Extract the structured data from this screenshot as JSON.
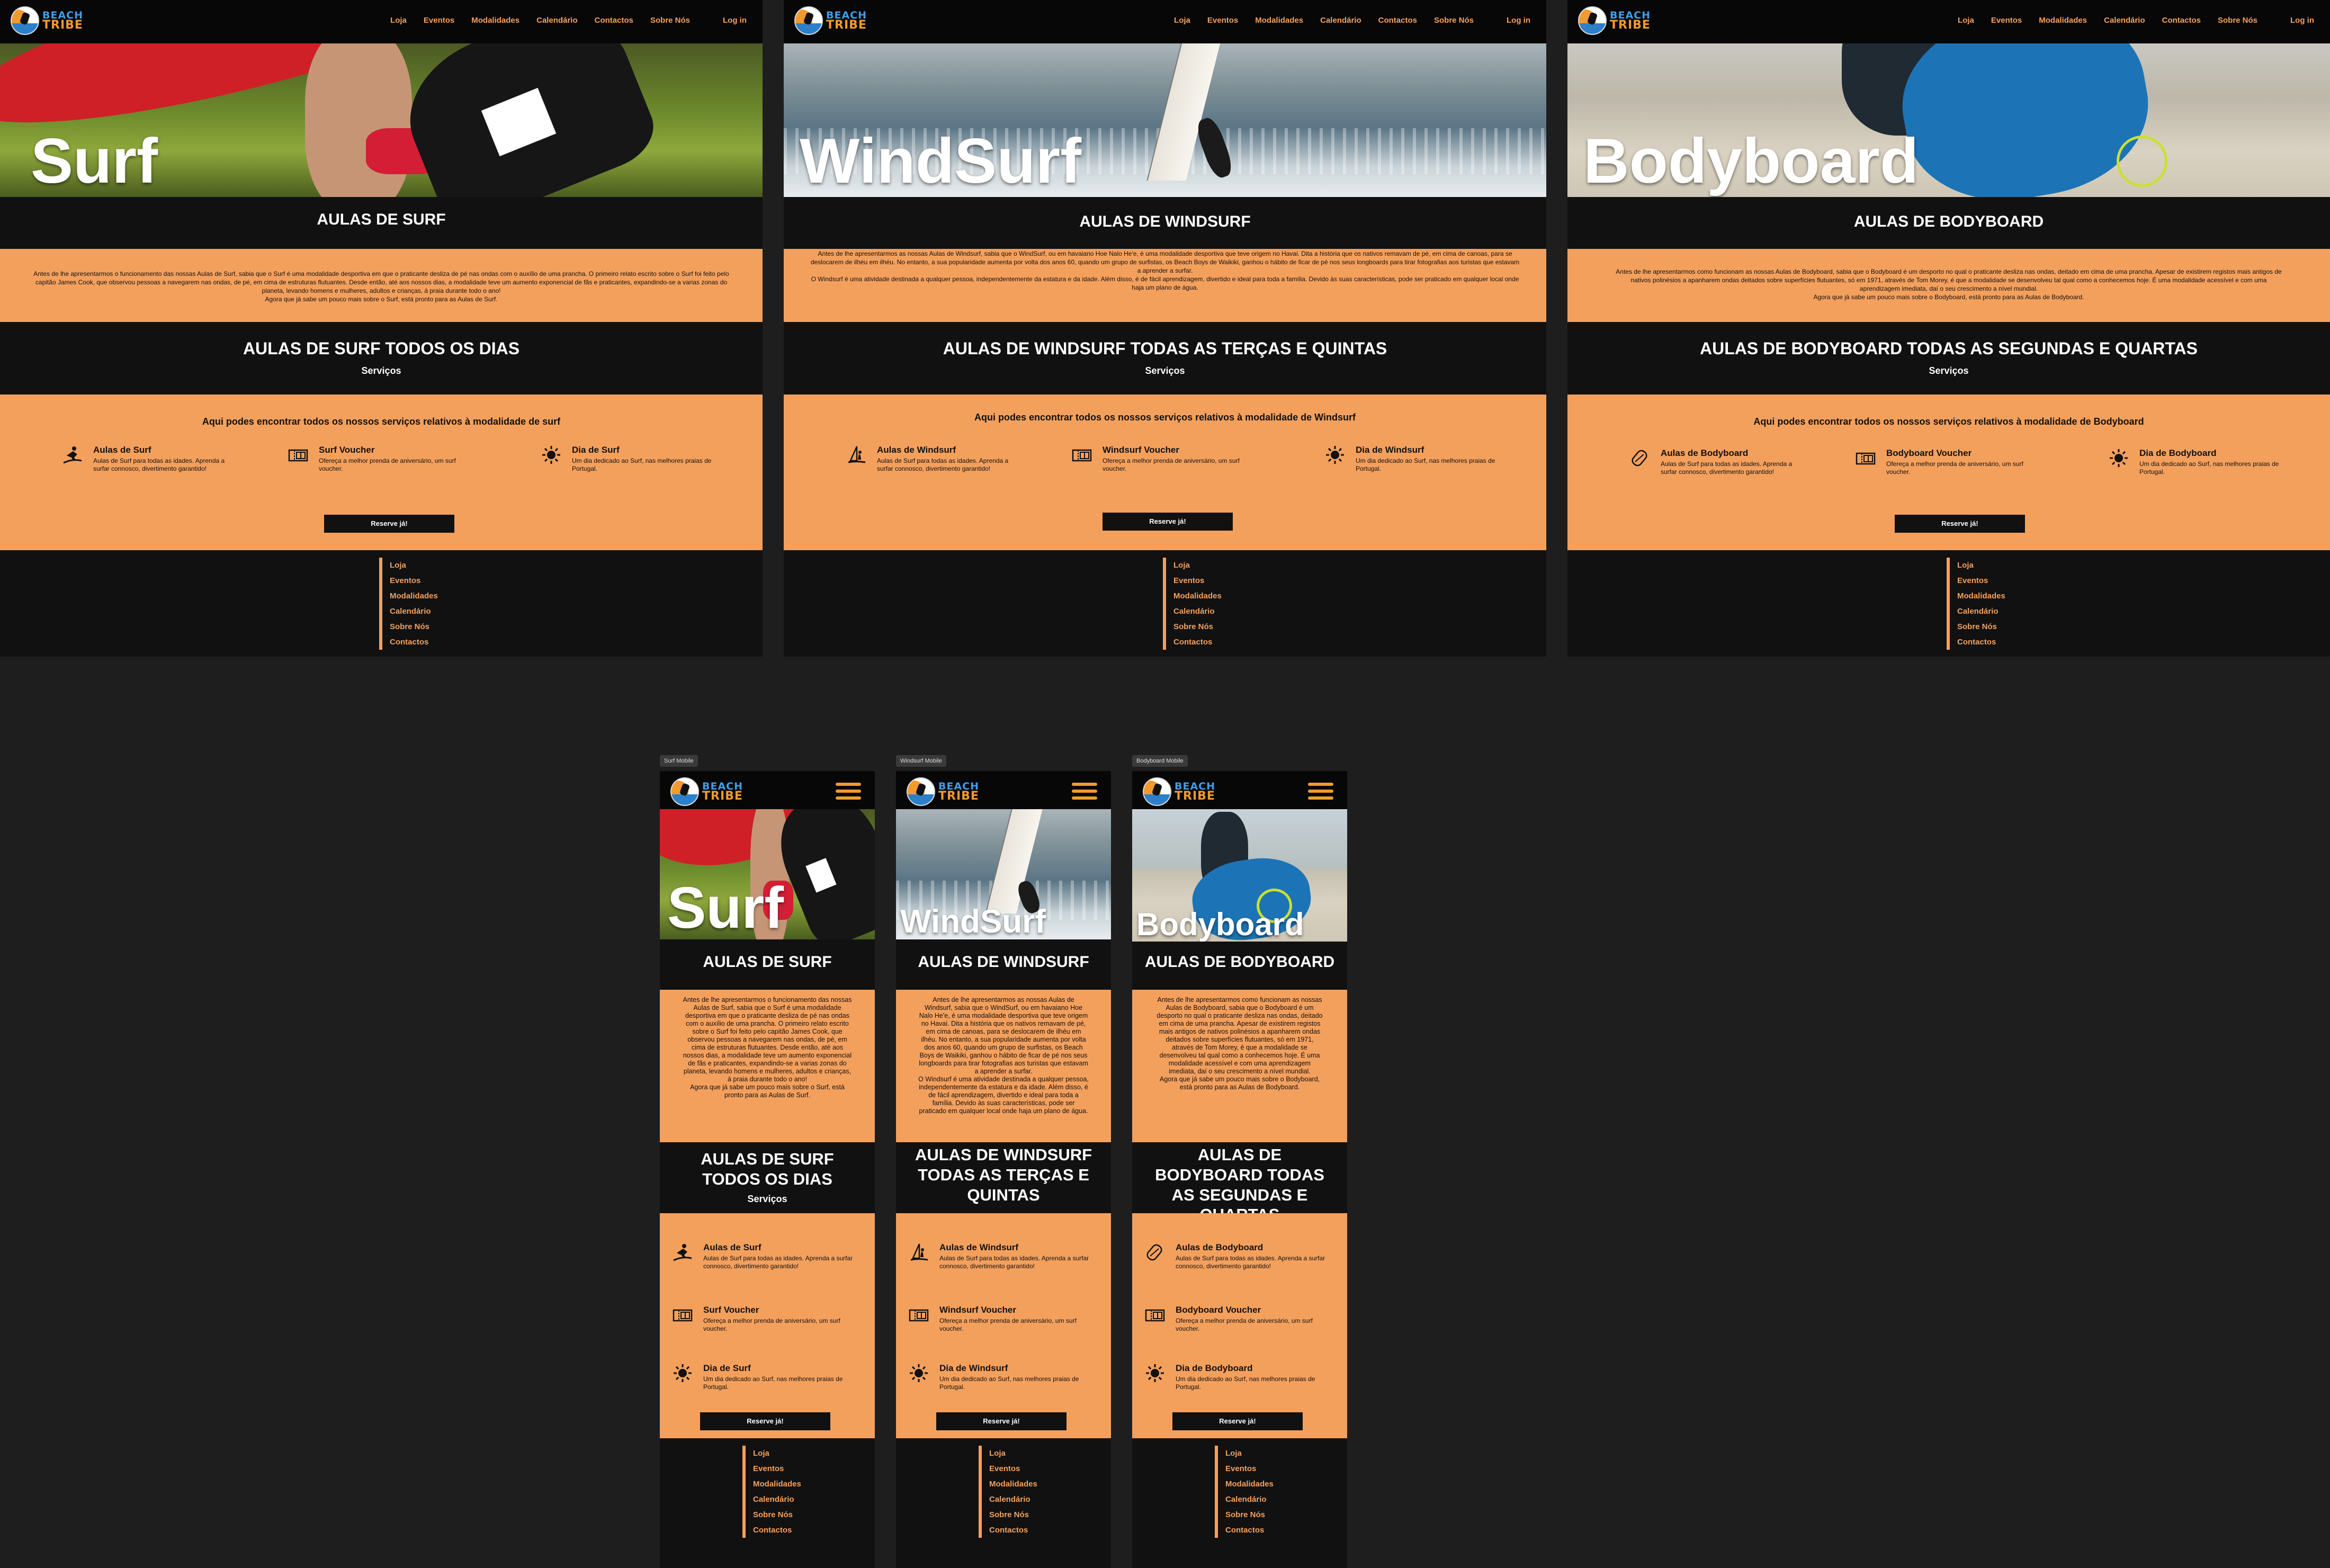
{
  "colors": {
    "accent": "#f4a05d",
    "nav_bg": "#070707",
    "page_bg": "#1e1e1e",
    "section_bg": "#111111",
    "logo_blue": "#3f9ee8",
    "logo_orange": "#f39a2d"
  },
  "logo": {
    "line1": "BEACH",
    "line2": "TRIBE"
  },
  "nav": {
    "items": [
      "Loja",
      "Eventos",
      "Modalidades",
      "Calendário",
      "Contactos",
      "Sobre Nós"
    ],
    "login": "Log in"
  },
  "footer": {
    "links": [
      "Loja",
      "Eventos",
      "Modalidades",
      "Calendário",
      "Sobre Nós",
      "Contactos"
    ]
  },
  "cta_label": "Reserve já!",
  "services_label": "Serviços",
  "frames": [
    {
      "hero": "Surf",
      "title": "AULAS DE SURF",
      "schedule": "AULAS DE SURF TODOS OS DIAS",
      "paragraph": "Antes de lhe apresentarmos o funcionamento das nossas Aulas de Surf, sabia que o Surf é uma modalidade desportiva em que o praticante  desliza de pé nas ondas com o auxílio de uma prancha. O primeiro relato escrito sobre o Surf foi feito pelo capitão James Cook, que observou  pessoas a navegarem nas ondas, de pé, em cima de estruturas flutuantes.  Desde então, até aos nossos dias, a modalidade teve um aumento exponencial de fãs e praticantes, expandindo-se a varias zonas do  planeta, levando homens e mulheres, adultos e crianças, à praia durante  todo o ano!\nAgora que já sabe um pouco mais sobre o Surf, está pronto para as Aulas de Surf.",
      "services_intro": "Aqui podes encontrar todos os nossos serviços relativos à modalidade de surf",
      "services": [
        {
          "icon": "surfer-icon",
          "title": "Aulas de Surf",
          "desc": "Aulas de Surf para todas as idades. Aprenda a surfar connosco, divertimento garantido!"
        },
        {
          "icon": "ticket-icon",
          "title": "Surf Voucher",
          "desc": "Ofereça a melhor prenda de aniversário, um surf voucher."
        },
        {
          "icon": "sun-icon",
          "title": "Dia de Surf",
          "desc": "Um dia dedicado ao Surf, nas melhores praias de Portugal."
        }
      ]
    },
    {
      "hero": "WindSurf",
      "title": "AULAS DE WINDSURF",
      "schedule": "AULAS DE WINDSURF TODAS AS TERÇAS E QUINTAS",
      "paragraph": "Antes de lhe apresentarmos as nossas Aulas de Windsurf, sabia que o WindSurf, ou em havaiano Hoe Nalo He'e, é uma  modalidade desportiva que teve origem no Havai. Dita a história que os  nativos remavam de pé, em cima de canoas, para se deslocarem de ilhéu em ilhéu. No entanto, a sua popularidade aumenta por volta dos anos 60,  quando um grupo de surfistas, os Beach Boys de Waikiki, ganhou o hábito  de ficar de pé nos seus longboards para tirar fotografias aos turistas  que estavam a aprender a surfar.\nO Windsurf é uma atividade destinada a qualquer pessoa, independentemente  da estatura e da idade. Além disso, é de fácil aprendizagem, divertido e ideal para toda a família. Devido às suas características, pode ser  praticado em qualquer local onde haja um plano de água.",
      "services_intro": "Aqui podes encontrar todos os nossos serviços relativos à modalidade de Windsurf",
      "services": [
        {
          "icon": "windsurfer-icon",
          "title": "Aulas de Windsurf",
          "desc": "Aulas de Surf para todas as idades. Aprenda a surfar connosco, divertimento garantido!"
        },
        {
          "icon": "ticket-icon",
          "title": "Windsurf Voucher",
          "desc": "Ofereça a melhor prenda de aniversário, um surf voucher."
        },
        {
          "icon": "sun-icon",
          "title": "Dia de Windsurf",
          "desc": "Um dia dedicado ao Surf, nas melhores praias de Portugal."
        }
      ]
    },
    {
      "hero": "Bodyboard",
      "title": "AULAS DE BODYBOARD",
      "schedule": "AULAS DE BODYBOARD TODAS AS SEGUNDAS E QUARTAS",
      "paragraph": "Antes de lhe apresentarmos como funcionam as nossas Aulas de Bodyboard, sabia que o Bodyboard é um desporto no qual o praticante desliza nas  ondas, deitado em cima de uma prancha. Apesar de existirem registos mais antigos de nativos polinésios a apanharem ondas deitados sobre  superfícies flutuantes, só em 1971, através de Tom Morey, é que a  modalidade se desenvolveu tal qual como a conhecemos hoje. É uma modalidade acessível e com uma aprendizagem imediata, daí o seu  crescimento a nível mundial.\nAgora que já sabe um pouco mais sobre o Bodyboard, está pronto para as Aulas de Bodyboard.",
      "services_intro": "Aqui podes encontrar todos os nossos serviços relativos à modalidade de Bodyboard",
      "services": [
        {
          "icon": "bodyboard-icon",
          "title": "Aulas de Bodyboard",
          "desc": "Aulas de Surf para todas as idades. Aprenda a surfar connosco, divertimento garantido!"
        },
        {
          "icon": "ticket-icon",
          "title": "Bodyboard Voucher",
          "desc": "Ofereça a melhor prenda de aniversário, um surf voucher."
        },
        {
          "icon": "sun-icon",
          "title": "Dia de Bodyboard",
          "desc": "Um dia dedicado ao Surf, nas melhores praias de Portugal."
        }
      ]
    }
  ],
  "mobile_labels": [
    "Surf Mobile",
    "Windsurf Mobile",
    "Bodyboard Mobile"
  ]
}
